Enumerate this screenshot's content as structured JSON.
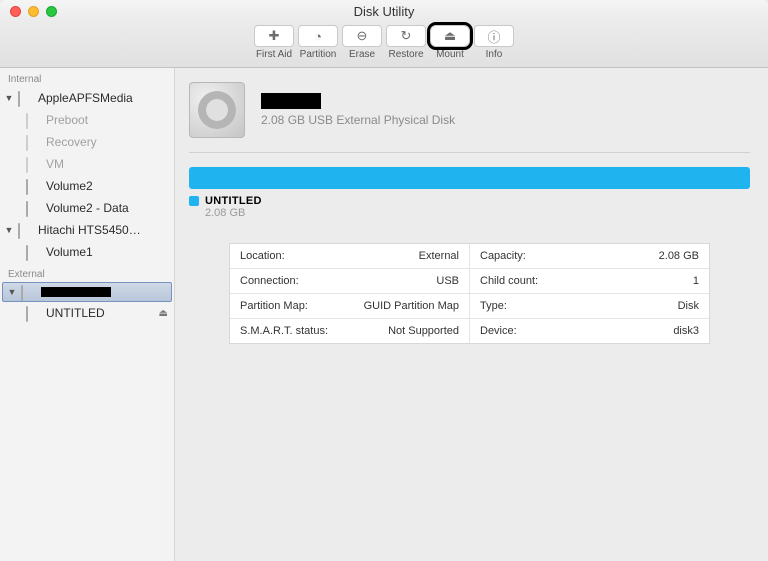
{
  "window": {
    "title": "Disk Utility"
  },
  "toolbar": [
    {
      "id": "firstaid",
      "label": "First Aid",
      "glyph": "✚"
    },
    {
      "id": "partition",
      "label": "Partition",
      "glyph": "◔"
    },
    {
      "id": "erase",
      "label": "Erase",
      "glyph": "⊖"
    },
    {
      "id": "restore",
      "label": "Restore",
      "glyph": "↻"
    },
    {
      "id": "mount",
      "label": "Mount",
      "glyph": "⏏",
      "highlight": true
    },
    {
      "id": "info",
      "label": "Info",
      "glyph": "ⓘ"
    }
  ],
  "sidebar": {
    "sections": [
      {
        "header": "Internal",
        "items": [
          {
            "name": "AppleAPFSMedia",
            "expanded": true,
            "children": [
              {
                "name": "Preboot",
                "dim": true
              },
              {
                "name": "Recovery",
                "dim": true
              },
              {
                "name": "VM",
                "dim": true
              },
              {
                "name": "Volume2"
              },
              {
                "name": "Volume2 - Data"
              }
            ]
          },
          {
            "name": "Hitachi HTS5450…",
            "expanded": true,
            "children": [
              {
                "name": "Volume1"
              }
            ]
          }
        ]
      },
      {
        "header": "External",
        "items": [
          {
            "name": "█████",
            "redacted": true,
            "selected": true,
            "expanded": true,
            "children": [
              {
                "name": "UNTITLED",
                "ejectable": true
              }
            ]
          }
        ]
      }
    ]
  },
  "disk": {
    "name_redacted": true,
    "subtitle": "2.08 GB USB External Physical Disk",
    "legend": {
      "name": "UNTITLED",
      "size": "2.08 GB"
    },
    "details": [
      [
        {
          "k": "Location:",
          "v": "External"
        },
        {
          "k": "Capacity:",
          "v": "2.08 GB"
        }
      ],
      [
        {
          "k": "Connection:",
          "v": "USB"
        },
        {
          "k": "Child count:",
          "v": "1"
        }
      ],
      [
        {
          "k": "Partition Map:",
          "v": "GUID Partition Map"
        },
        {
          "k": "Type:",
          "v": "Disk"
        }
      ],
      [
        {
          "k": "S.M.A.R.T. status:",
          "v": "Not Supported"
        },
        {
          "k": "Device:",
          "v": "disk3"
        }
      ]
    ]
  }
}
